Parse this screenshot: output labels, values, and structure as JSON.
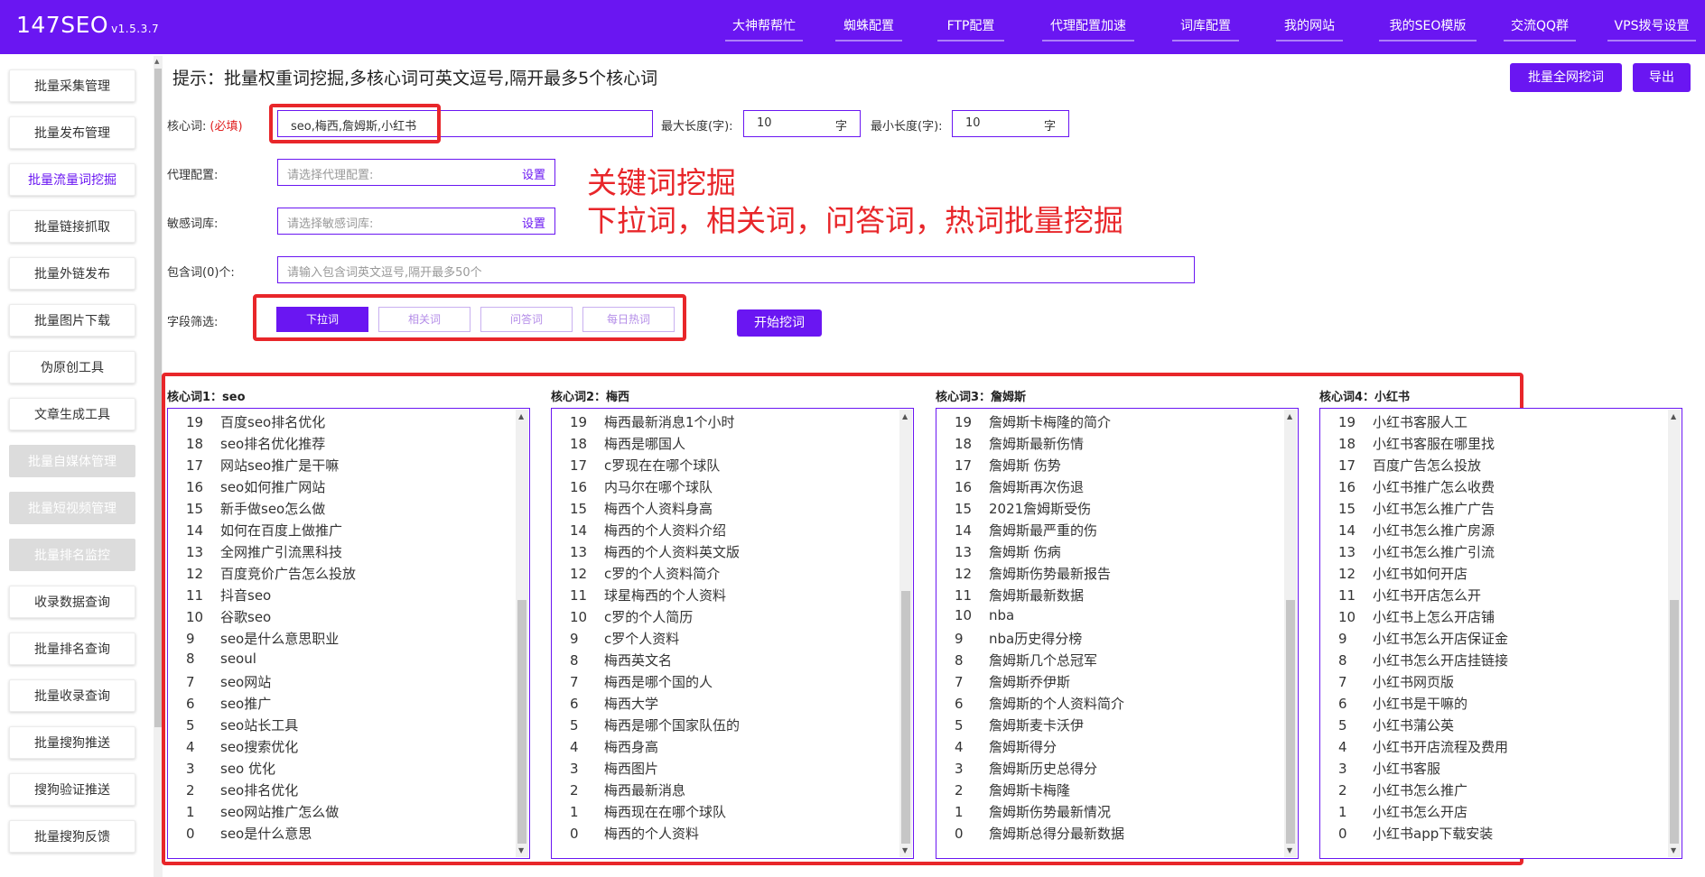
{
  "app": {
    "name": "147SEO",
    "version": "v1.5.3.7"
  },
  "nav": [
    "大神帮帮忙",
    "蜘蛛配置",
    "FTP配置",
    "代理配置加速",
    "词库配置",
    "我的网站",
    "我的SEO模版",
    "交流QQ群",
    "VPS拨号设置"
  ],
  "sidebar": [
    {
      "label": "批量采集管理",
      "state": "normal"
    },
    {
      "label": "批量发布管理",
      "state": "normal"
    },
    {
      "label": "批量流量词挖掘",
      "state": "active"
    },
    {
      "label": "批量链接抓取",
      "state": "normal"
    },
    {
      "label": "批量外链发布",
      "state": "normal"
    },
    {
      "label": "批量图片下载",
      "state": "normal"
    },
    {
      "label": "伪原创工具",
      "state": "normal"
    },
    {
      "label": "文章生成工具",
      "state": "normal"
    },
    {
      "label": "批量自媒体管理",
      "state": "disabled"
    },
    {
      "label": "批量短视频管理",
      "state": "disabled"
    },
    {
      "label": "批量排名监控",
      "state": "disabled"
    },
    {
      "label": "收录数据查询",
      "state": "normal"
    },
    {
      "label": "批量排名查询",
      "state": "normal"
    },
    {
      "label": "批量收录查询",
      "state": "normal"
    },
    {
      "label": "批量搜狗推送",
      "state": "normal"
    },
    {
      "label": "搜狗验证推送",
      "state": "normal"
    },
    {
      "label": "批量搜狗反馈",
      "state": "normal"
    }
  ],
  "hint": "提示：批量权重词挖掘,多核心词可英文逗号,隔开最多5个核心词",
  "actions": {
    "batch_mine": "批量全网挖词",
    "export": "导出",
    "start": "开始挖词"
  },
  "form": {
    "core_label": "核心词:",
    "core_required": "(必填)",
    "core_value": "seo,梅西,詹姆斯,小红书",
    "max_len_label": "最大长度(字):",
    "max_len_value": "10",
    "min_len_label": "最小长度(字):",
    "min_len_value": "10",
    "len_unit": "字",
    "proxy_label": "代理配置:",
    "proxy_placeholder": "请选择代理配置:",
    "sensitive_label": "敏感词库:",
    "sensitive_placeholder": "请选择敏感词库:",
    "set_label": "设置",
    "include_label": "包含词(0)个:",
    "include_placeholder": "请输入包含词英文逗号,隔开最多50个",
    "filter_label": "字段筛选:",
    "filters": [
      {
        "label": "下拉词",
        "selected": true
      },
      {
        "label": "相关词",
        "selected": false
      },
      {
        "label": "问答词",
        "selected": false
      },
      {
        "label": "每日热词",
        "selected": false
      }
    ]
  },
  "annotation": {
    "line1": "关键词挖掘",
    "line2": "下拉词，相关词，问答词，热词批量挖掘"
  },
  "results": [
    {
      "title": "核心词1：seo",
      "scroll_thumb_fraction": 0.58,
      "items": [
        {
          "n": "19",
          "text": "百度seo排名优化"
        },
        {
          "n": "18",
          "text": "seo排名优化推荐"
        },
        {
          "n": "17",
          "text": "网站seo推广是干嘛"
        },
        {
          "n": "16",
          "text": "seo如何推广网站"
        },
        {
          "n": "15",
          "text": "新手做seo怎么做"
        },
        {
          "n": "14",
          "text": "如何在百度上做推广"
        },
        {
          "n": "13",
          "text": "全网推广引流黑科技"
        },
        {
          "n": "12",
          "text": "百度竞价广告怎么投放"
        },
        {
          "n": "11",
          "text": "抖音seo"
        },
        {
          "n": "10",
          "text": "谷歌seo"
        },
        {
          "n": "9",
          "text": "seo是什么意思职业"
        },
        {
          "n": "8",
          "text": "seoul"
        },
        {
          "n": "7",
          "text": "seo网站"
        },
        {
          "n": "6",
          "text": "seo推广"
        },
        {
          "n": "5",
          "text": "seo站长工具"
        },
        {
          "n": "4",
          "text": "seo搜索优化"
        },
        {
          "n": "3",
          "text": "seo 优化"
        },
        {
          "n": "2",
          "text": "seo排名优化"
        },
        {
          "n": "1",
          "text": "seo网站推广怎么做"
        },
        {
          "n": "0",
          "text": "seo是什么意思"
        }
      ]
    },
    {
      "title": "核心词2：梅西",
      "scroll_thumb_fraction": 0.6,
      "items": [
        {
          "n": "19",
          "text": "梅西最新消息1个小时"
        },
        {
          "n": "18",
          "text": "梅西是哪国人"
        },
        {
          "n": "17",
          "text": "c罗现在在哪个球队"
        },
        {
          "n": "16",
          "text": "内马尔在哪个球队"
        },
        {
          "n": "15",
          "text": "梅西个人资料身高"
        },
        {
          "n": "14",
          "text": "梅西的个人资料介绍"
        },
        {
          "n": "13",
          "text": "梅西的个人资料英文版"
        },
        {
          "n": "12",
          "text": "c罗的个人资料简介"
        },
        {
          "n": "11",
          "text": "球星梅西的个人资料"
        },
        {
          "n": "10",
          "text": "c罗的个人简历"
        },
        {
          "n": "9",
          "text": "c罗个人资料"
        },
        {
          "n": "8",
          "text": "梅西英文名"
        },
        {
          "n": "7",
          "text": "梅西是哪个国的人"
        },
        {
          "n": "6",
          "text": "梅西大学"
        },
        {
          "n": "5",
          "text": "梅西是哪个国家队伍的"
        },
        {
          "n": "4",
          "text": "梅西身高"
        },
        {
          "n": "3",
          "text": "梅西图片"
        },
        {
          "n": "2",
          "text": "梅西最新消息"
        },
        {
          "n": "1",
          "text": "梅西现在在哪个球队"
        },
        {
          "n": "0",
          "text": "梅西的个人资料"
        }
      ]
    },
    {
      "title": "核心词3：詹姆斯",
      "scroll_thumb_fraction": 0.58,
      "items": [
        {
          "n": "19",
          "text": "詹姆斯卡梅隆的简介"
        },
        {
          "n": "18",
          "text": "詹姆斯最新伤情"
        },
        {
          "n": "17",
          "text": "詹姆斯 伤势"
        },
        {
          "n": "16",
          "text": "詹姆斯再次伤退"
        },
        {
          "n": "15",
          "text": "2021詹姆斯受伤"
        },
        {
          "n": "14",
          "text": "詹姆斯最严重的伤"
        },
        {
          "n": "13",
          "text": "詹姆斯 伤病"
        },
        {
          "n": "12",
          "text": "詹姆斯伤势最新报告"
        },
        {
          "n": "11",
          "text": "詹姆斯最新数据"
        },
        {
          "n": "10",
          "text": "nba"
        },
        {
          "n": "9",
          "text": "nba历史得分榜"
        },
        {
          "n": "8",
          "text": "詹姆斯几个总冠军"
        },
        {
          "n": "7",
          "text": "詹姆斯乔伊斯"
        },
        {
          "n": "6",
          "text": "詹姆斯的个人资料简介"
        },
        {
          "n": "5",
          "text": "詹姆斯麦卡沃伊"
        },
        {
          "n": "4",
          "text": "詹姆斯得分"
        },
        {
          "n": "3",
          "text": "詹姆斯历史总得分"
        },
        {
          "n": "2",
          "text": "詹姆斯卡梅隆"
        },
        {
          "n": "1",
          "text": "詹姆斯伤势最新情况"
        },
        {
          "n": "0",
          "text": "詹姆斯总得分最新数据"
        }
      ]
    },
    {
      "title": "核心词4：小红书",
      "scroll_thumb_fraction": 0.58,
      "items": [
        {
          "n": "19",
          "text": "小红书客服人工"
        },
        {
          "n": "18",
          "text": "小红书客服在哪里找"
        },
        {
          "n": "17",
          "text": "百度广告怎么投放"
        },
        {
          "n": "16",
          "text": "小红书推广怎么收费"
        },
        {
          "n": "15",
          "text": "小红书怎么推广广告"
        },
        {
          "n": "14",
          "text": "小红书怎么推广房源"
        },
        {
          "n": "13",
          "text": "小红书怎么推广引流"
        },
        {
          "n": "12",
          "text": "小红书如何开店"
        },
        {
          "n": "11",
          "text": "小红书开店怎么开"
        },
        {
          "n": "10",
          "text": "小红书上怎么开店铺"
        },
        {
          "n": "9",
          "text": "小红书怎么开店保证金"
        },
        {
          "n": "8",
          "text": "小红书怎么开店挂链接"
        },
        {
          "n": "7",
          "text": "小红书网页版"
        },
        {
          "n": "6",
          "text": "小红书是干嘛的"
        },
        {
          "n": "5",
          "text": "小红书蒲公英"
        },
        {
          "n": "4",
          "text": "小红书开店流程及费用"
        },
        {
          "n": "3",
          "text": "小红书客服"
        },
        {
          "n": "2",
          "text": "小红书怎么推广"
        },
        {
          "n": "1",
          "text": "小红书怎么开店"
        },
        {
          "n": "0",
          "text": "小红书app下载安装"
        }
      ]
    }
  ],
  "colors": {
    "brand": "#6a16f2",
    "annotation_red": "#e8262a",
    "disabled_bg": "#dcdcdc"
  }
}
